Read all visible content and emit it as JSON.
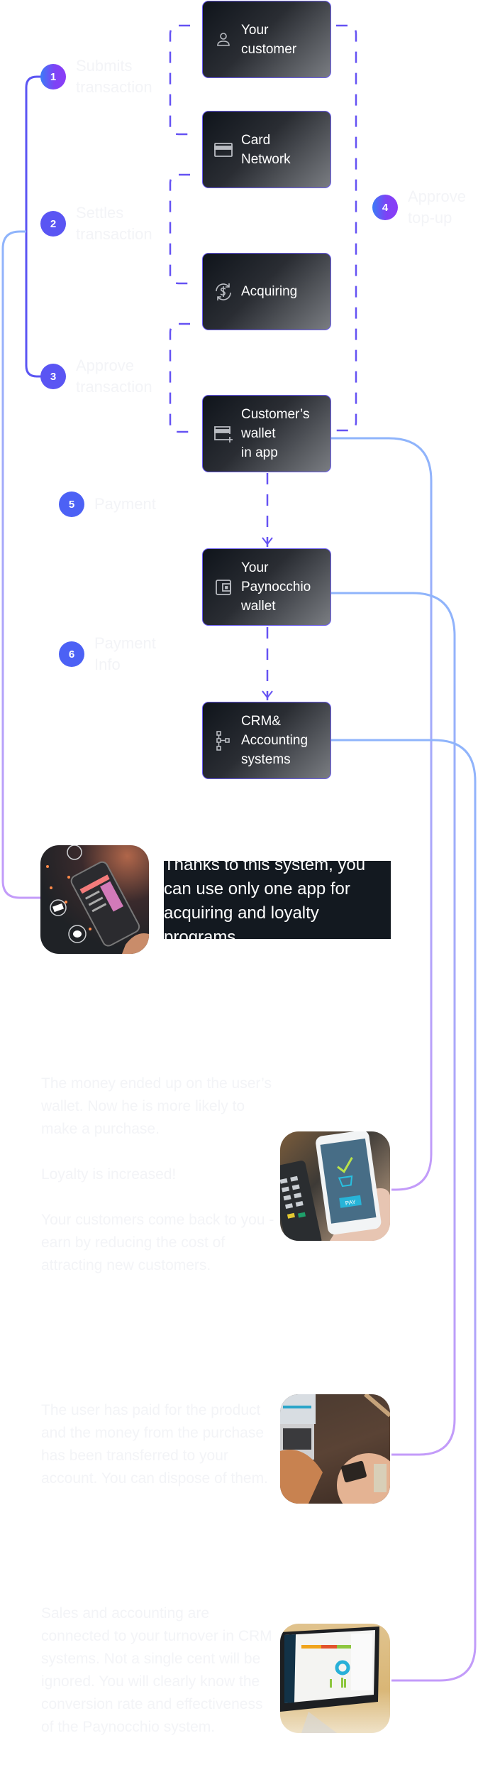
{
  "nodes": [
    {
      "id": "customer",
      "label": "Your\ncustomer",
      "icon": "user-icon"
    },
    {
      "id": "card-network",
      "label": "Card\nNetwork",
      "icon": "credit-card-icon"
    },
    {
      "id": "acquiring",
      "label": "Acquiring",
      "icon": "currency-exchange-icon"
    },
    {
      "id": "customer-wallet",
      "label": "Customer’s\nwallet\nin app",
      "icon": "wallet-add-icon"
    },
    {
      "id": "paynocchio-wallet",
      "label": "Your\nPaynocchio\nwallet",
      "icon": "wallet-icon"
    },
    {
      "id": "crm",
      "label": "CRM&\nAccounting\nsystems",
      "icon": "network-tree-icon"
    }
  ],
  "steps": [
    {
      "number": "1",
      "label": "Submits\ntransaction"
    },
    {
      "number": "2",
      "label": "Settles\ntransaction"
    },
    {
      "number": "3",
      "label": "Approve\ntransaction"
    },
    {
      "number": "4",
      "label": "Approve\ntop-up"
    },
    {
      "number": "5",
      "label": "Payment"
    },
    {
      "number": "6",
      "label": "Payment\nInfo"
    }
  ],
  "callout": {
    "text": "Thanks to this system, you can use only one app for acquiring and loyalty programs."
  },
  "sections": [
    {
      "paragraphs": [
        "The money ended up on the user’s wallet. Now he is more likely to make a purchase.",
        "Loyalty is increased!",
        "Your customers come back to you - earn by reducing the cost of attracting new customers."
      ],
      "image": "phone-payment-photo"
    },
    {
      "paragraphs": [
        "The user has paid for the product and the money from the purchase has been transferred to your account. You can dispose of them."
      ],
      "image": "laptop-wallet-photo"
    },
    {
      "paragraphs": [
        "Sales and accounting are connected to your turnover in CRM systems. Not a single cent will be ignored. You will clearly know the conversion rate and effectiveness of the Paynocchio system."
      ],
      "image": "crm-dashboard-photo"
    }
  ],
  "photo_images": {
    "intro": "online-banking-phone-photo",
    "phone_pay_button": "PAY"
  },
  "colors": {
    "accent_purple": "#6a5cf2",
    "line_blue": "#8fb4fb",
    "line_violet": "#c39bf9",
    "node_dark": "#0f141b"
  }
}
